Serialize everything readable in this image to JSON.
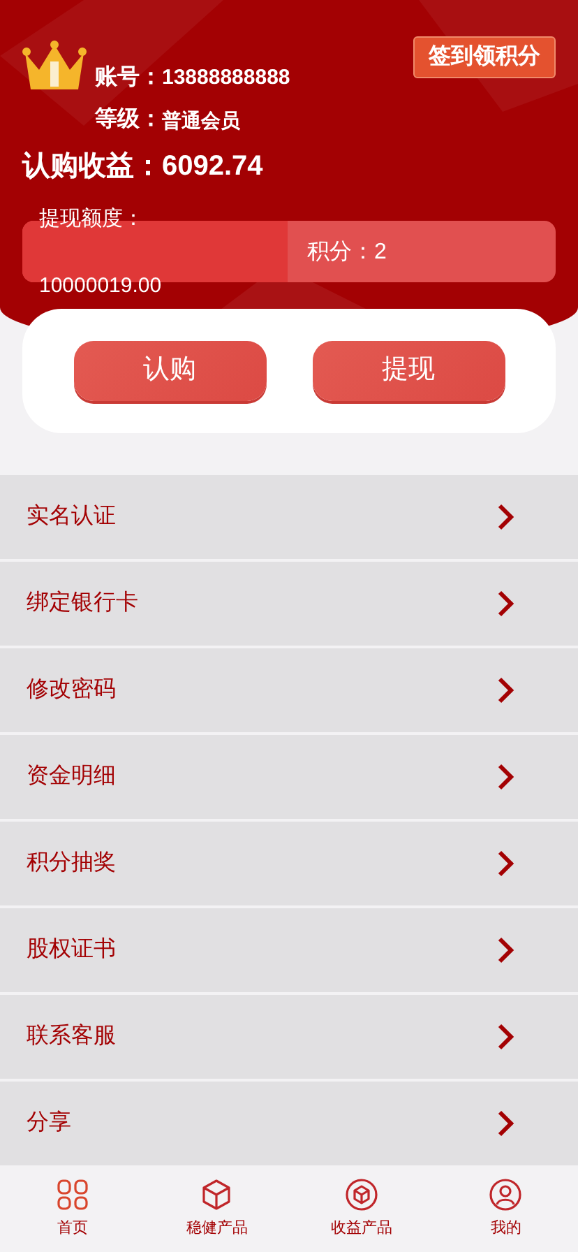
{
  "header": {
    "checkin_button": "签到领积分",
    "account_label": "账号：",
    "account": "13888888888",
    "level_label": "等级：",
    "level_value": "普通会员",
    "earnings_label": "认购收益：",
    "earnings": "6092.74",
    "quota_label": "提现额度：",
    "quota": "10000019.00",
    "points_label": "积分：",
    "points": "2"
  },
  "actions": [
    "认购",
    "提现"
  ],
  "menu": [
    "实名认证",
    "绑定银行卡",
    "修改密码",
    "资金明细",
    "积分抽奖",
    "股权证书",
    "联系客服",
    "分享"
  ],
  "tabbar": [
    {
      "label": "首页",
      "kind": "grid"
    },
    {
      "label": "稳健产品",
      "kind": "cube"
    },
    {
      "label": "收益产品",
      "kind": "cube-circle"
    },
    {
      "label": "我的",
      "kind": "user"
    }
  ]
}
